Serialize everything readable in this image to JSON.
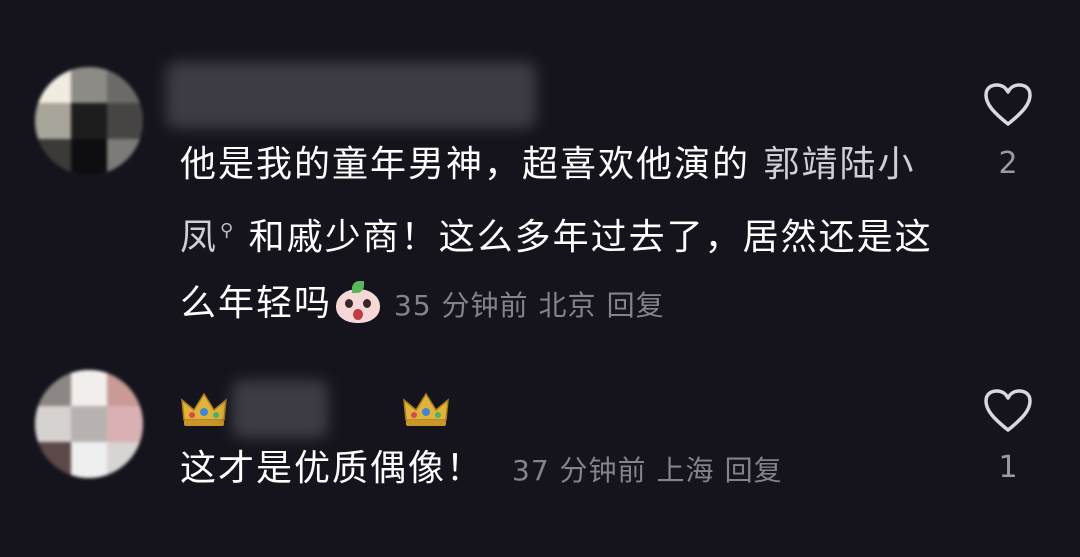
{
  "comments": [
    {
      "text": "他是我的童年男神，超喜欢他演的 ",
      "tag": "郭靖陆小凤",
      "text_after": " 和戚少商！这么多年过去了，居然还是这么年轻吗",
      "time": "35 分钟前",
      "location": "北京",
      "reply_label": "回复",
      "likes": "2"
    },
    {
      "text": "这才是优质偶像！",
      "time": "37 分钟前",
      "location": "上海",
      "reply_label": "回复",
      "likes": "1"
    }
  ],
  "icons": {
    "like": "heart-outline-icon",
    "search": "search-icon",
    "emoji": "surprised-face-emoji",
    "badge": "crown-icon"
  },
  "colors": {
    "background": "#15141c",
    "text": "#ffffff",
    "meta": "#83828d",
    "count": "#9a99a4"
  }
}
